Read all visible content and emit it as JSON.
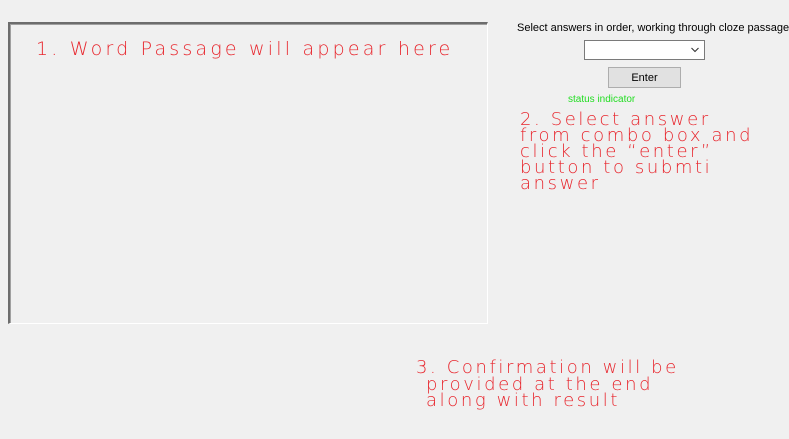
{
  "passage_box": {
    "text": ""
  },
  "controls": {
    "instruction_label": "Select answers in order, working through cloze passage",
    "combo_value": "",
    "combo_arrow_icon": "chevron-down-icon",
    "enter_button_label": "Enter",
    "status_text": "status indicator",
    "status_color": "#22dd22"
  },
  "annotations": {
    "color": "#e8262d",
    "note1": "1. Word Passage will appear here",
    "note2_lines": [
      "2. Select answer",
      "from combo box and",
      "click the “enter”",
      "button to submti",
      "answer"
    ],
    "note3_lines": [
      "3. Confirmation will be",
      "provided at the end",
      "along with result"
    ]
  }
}
